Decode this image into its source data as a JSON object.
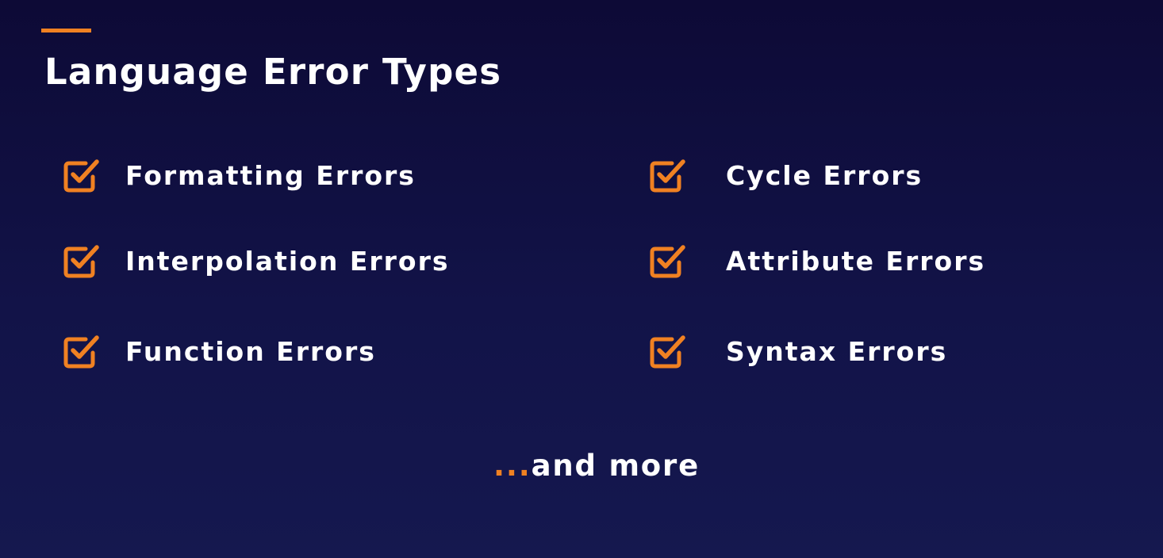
{
  "slide": {
    "title": "Language Error Types",
    "accent_color": "#f08122",
    "background_colors": [
      "#0d0a36",
      "#15184f"
    ],
    "items": [
      {
        "label": "Formatting Errors",
        "icon": "checkbox-checked-icon"
      },
      {
        "label": "Interpolation Errors",
        "icon": "checkbox-checked-icon"
      },
      {
        "label": "Function Errors",
        "icon": "checkbox-checked-icon"
      },
      {
        "label": "Cycle Errors",
        "icon": "checkbox-checked-icon"
      },
      {
        "label": "Attribute Errors",
        "icon": "checkbox-checked-icon"
      },
      {
        "label": "Syntax Errors",
        "icon": "checkbox-checked-icon"
      }
    ],
    "footer": {
      "ellipsis": "...",
      "text": "and more"
    }
  }
}
